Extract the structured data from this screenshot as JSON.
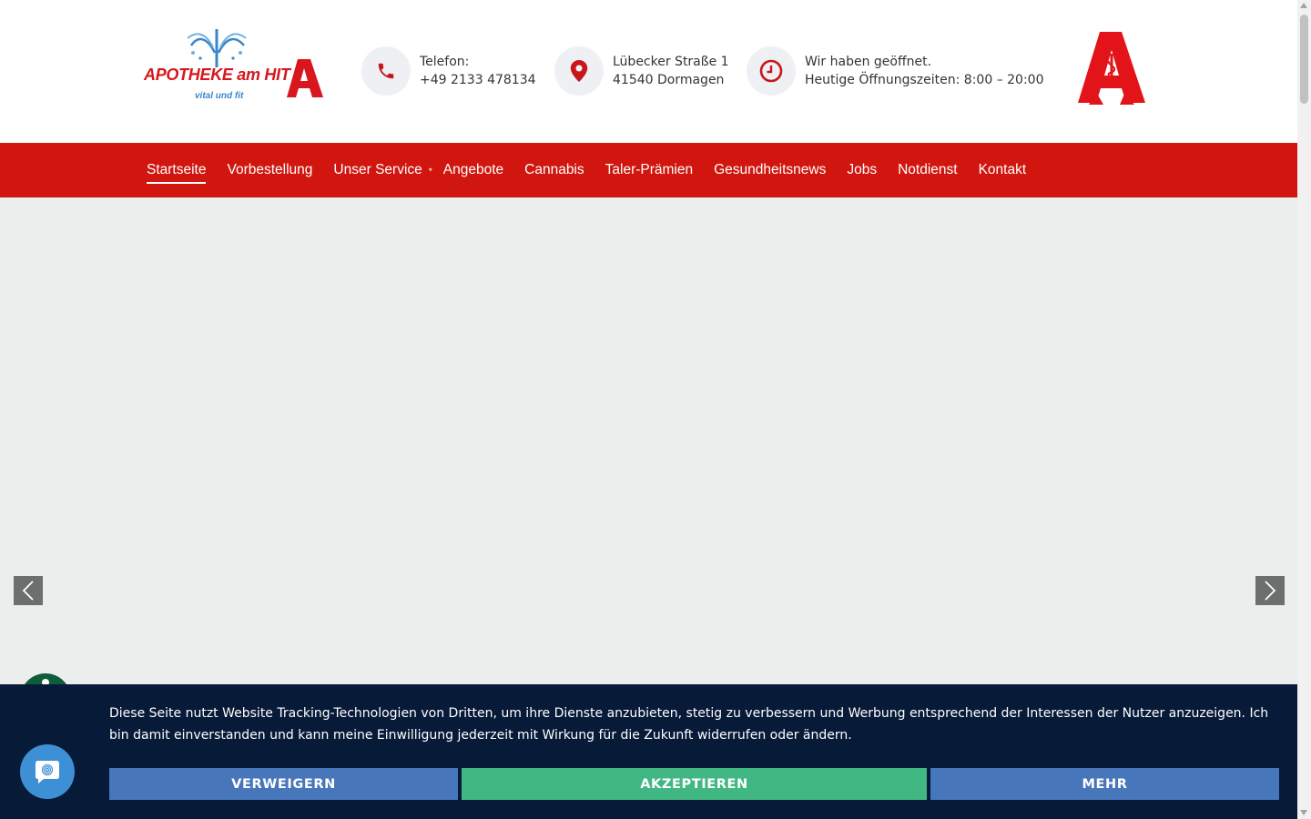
{
  "header": {
    "logo": {
      "brand": "APOTHEKE am HIT",
      "tagline": "vital und fit"
    },
    "phone": {
      "icon": "phone-icon",
      "label": "Telefon:",
      "value": "+49 2133 478134"
    },
    "address": {
      "icon": "location-pin-icon",
      "street": "Lübecker Straße 1",
      "city": "41540 Dormagen"
    },
    "hours": {
      "icon": "clock-icon",
      "status": "Wir haben geöffnet.",
      "today": "Heutige Öffnungszeiten: 8:00 – 20:00"
    }
  },
  "nav": {
    "items": [
      {
        "label": "Startseite",
        "active": true
      },
      {
        "label": "Vorbestellung"
      },
      {
        "label": "Unser Service",
        "has_submenu": true
      },
      {
        "label": "Angebote"
      },
      {
        "label": "Cannabis"
      },
      {
        "label": "Taler-Prämien"
      },
      {
        "label": "Gesundheitsnews"
      },
      {
        "label": "Jobs"
      },
      {
        "label": "Notdienst"
      },
      {
        "label": "Kontakt"
      }
    ]
  },
  "slider": {
    "prev_icon": "chevron-left-icon",
    "next_icon": "chevron-right-icon"
  },
  "cookie": {
    "message": "Diese Seite nutzt Website Tracking-Technologien von Dritten, um ihre Dienste anzubieten, stetig zu verbessern und Werbung entsprechend der Interessen der Nutzer anzuzeigen. Ich bin damit einverstanden und kann meine Einwilligung jederzeit mit Wirkung für die Zukunft widerrufen oder ändern.",
    "deny_label": "VERWEIGERN",
    "accept_label": "AKZEPTIEREN",
    "more_label": "MEHR"
  },
  "colors": {
    "brand_red": "#d0160f",
    "banner_bg": "#071a38",
    "deny_blue": "#4876bb",
    "accept_green": "#41b883",
    "hero_bg": "#eceeed"
  }
}
